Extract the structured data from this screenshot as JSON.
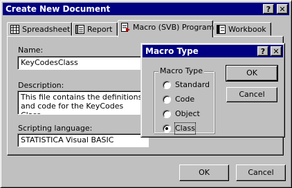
{
  "window": {
    "title": "Create New Document",
    "help_btn": "?",
    "close_btn": "✕"
  },
  "tabs": [
    {
      "label": "Spreadsheet",
      "icon": "spreadsheet-icon"
    },
    {
      "label": "Report",
      "icon": "report-icon"
    },
    {
      "label": "Macro (SVB) Program",
      "icon": "macro-program-icon"
    },
    {
      "label": "Workbook",
      "icon": "workbook-icon"
    }
  ],
  "form": {
    "name_label": "Name:",
    "name_value": "KeyCodesClass",
    "description_label": "Description:",
    "description_value": "This file contains the definitions\nand code for the KeyCodes Class",
    "scripting_label": "Scripting language:",
    "scripting_value": "STATISTICA Visual BASIC"
  },
  "footer": {
    "ok": "OK",
    "cancel": "Cancel"
  },
  "macro_dialog": {
    "title": "Macro Type",
    "help_btn": "?",
    "close_btn": "✕",
    "group_label": "Macro Type",
    "options": [
      {
        "label": "Standard",
        "selected": false
      },
      {
        "label": "Code",
        "selected": false
      },
      {
        "label": "Object",
        "selected": false
      },
      {
        "label": "Class",
        "selected": true
      }
    ],
    "ok": "OK",
    "cancel": "Cancel"
  }
}
